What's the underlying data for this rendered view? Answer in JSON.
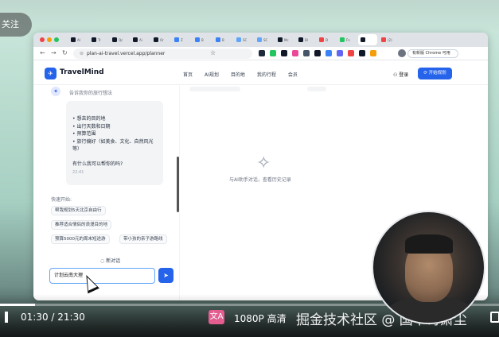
{
  "overlay": {
    "follow_label": "关注"
  },
  "browser": {
    "tabs": [
      {
        "label": "AI",
        "color": "#111827"
      },
      {
        "label": "Tr",
        "color": "#111827"
      },
      {
        "label": "Qc",
        "color": "#111827"
      },
      {
        "label": "Ai",
        "color": "#111827"
      },
      {
        "label": "Or",
        "color": "#111827"
      },
      {
        "label": "Z",
        "color": "#3b82f6"
      },
      {
        "label": "B",
        "color": "#3b82f6"
      },
      {
        "label": "B",
        "color": "#3b82f6"
      },
      {
        "label": "SC",
        "color": "#60a5fa"
      },
      {
        "label": "SC",
        "color": "#60a5fa"
      },
      {
        "label": "Mc",
        "color": "#111827"
      },
      {
        "label": "Bl",
        "color": "#111827"
      },
      {
        "label": "D",
        "color": "#ef4444"
      },
      {
        "label": "Fn",
        "color": "#22c55e"
      },
      {
        "label": "",
        "color": "#111827",
        "active": true
      },
      {
        "label": "(2)",
        "color": "#ef4444"
      }
    ],
    "url": "plan-ai-travel.vercel.app/planner",
    "chrome_pill": "有新版 Chrome 可用",
    "extensions": [
      "#1e293b",
      "#22c55e",
      "#111827",
      "#ec4899",
      "#475569",
      "#111827",
      "#3b82f6",
      "#6366f1",
      "#ef4444",
      "#111827",
      "#f59e0b"
    ]
  },
  "header": {
    "logo_text": "TravelMind",
    "nav": [
      "首页",
      "AI规划",
      "目的地",
      "我的行程",
      "会员"
    ],
    "login": "登录",
    "start_button": "开始规划"
  },
  "chat": {
    "subtitle": "告诉我你的旅行想法",
    "bullets": [
      "• 想去的目的地",
      "• 出行天数和日期",
      "• 预算范围",
      "• 旅行偏好（如美食、文化、自然风光",
      "等）"
    ],
    "question": "有什么我可以帮你的吗?",
    "time": "22:41",
    "quick_title": "快速开始:",
    "chips": [
      "帮我规划5天北京自由行",
      "推荐适合情侣的浪漫目的地",
      "预算5000元的周末短途游",
      "带小孩的亲子游路线"
    ],
    "new_chat": "新对话",
    "input_value": "计划云南大理"
  },
  "empty_state": {
    "text": "与AI助手对话，查看历史记录"
  },
  "player": {
    "time": "01:30  /  21:30",
    "quality": "1080P 高清",
    "watermark": "掘金技术社区 @ 国中哥萧尘",
    "progress": 0.07,
    "subtitle_icon": "文A"
  }
}
